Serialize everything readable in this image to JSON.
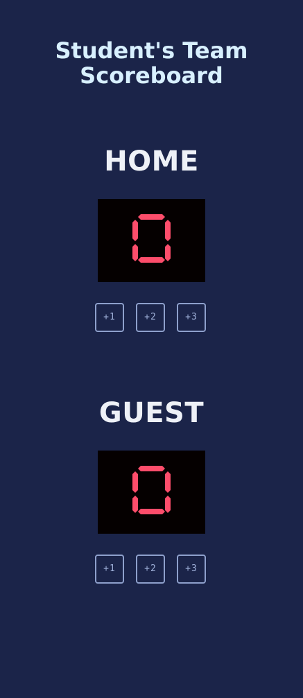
{
  "app": {
    "title": "Student's Team Scoreboard"
  },
  "teams": [
    {
      "name": "HOME",
      "score": "0",
      "buttons": [
        "+1",
        "+2",
        "+3"
      ]
    },
    {
      "name": "GUEST",
      "score": "0",
      "buttons": [
        "+1",
        "+2",
        "+3"
      ]
    }
  ],
  "colors": {
    "background": "#1b2449",
    "title": "#d8f0ff",
    "team_name": "#eef1f7",
    "score_bg": "#050000",
    "score_digit": "#fd4d6b",
    "button_border": "#8ea0cc"
  }
}
